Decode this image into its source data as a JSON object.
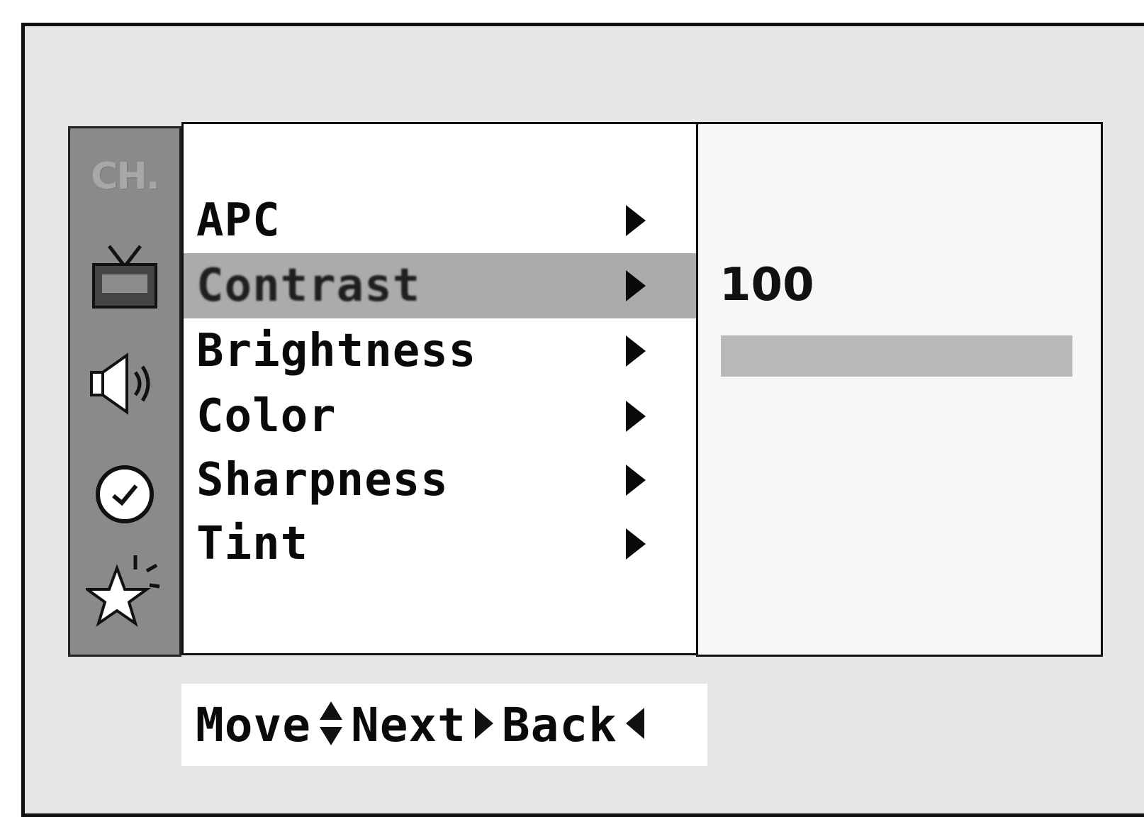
{
  "sidebar": {
    "items": [
      {
        "id": "channel",
        "label": "CH.",
        "icon": "ch-text-icon"
      },
      {
        "id": "picture",
        "icon": "tv-icon"
      },
      {
        "id": "sound",
        "icon": "speaker-icon"
      },
      {
        "id": "time",
        "icon": "clock-icon"
      },
      {
        "id": "special",
        "icon": "star-icon"
      }
    ]
  },
  "menu": {
    "items": [
      {
        "label": "APC",
        "selected": false
      },
      {
        "label": "Contrast",
        "selected": true
      },
      {
        "label": "Brightness",
        "selected": false
      },
      {
        "label": "Color",
        "selected": false
      },
      {
        "label": "Sharpness",
        "selected": false
      },
      {
        "label": "Tint",
        "selected": false
      }
    ]
  },
  "value_panel": {
    "value": "100",
    "level_percent": 100
  },
  "hints": {
    "move": "Move",
    "next": "Next",
    "back": "Back"
  },
  "colors": {
    "sidebar": "#8a8a8a",
    "selected_row": "#ababab",
    "slider_fill": "#b8b8b8"
  }
}
